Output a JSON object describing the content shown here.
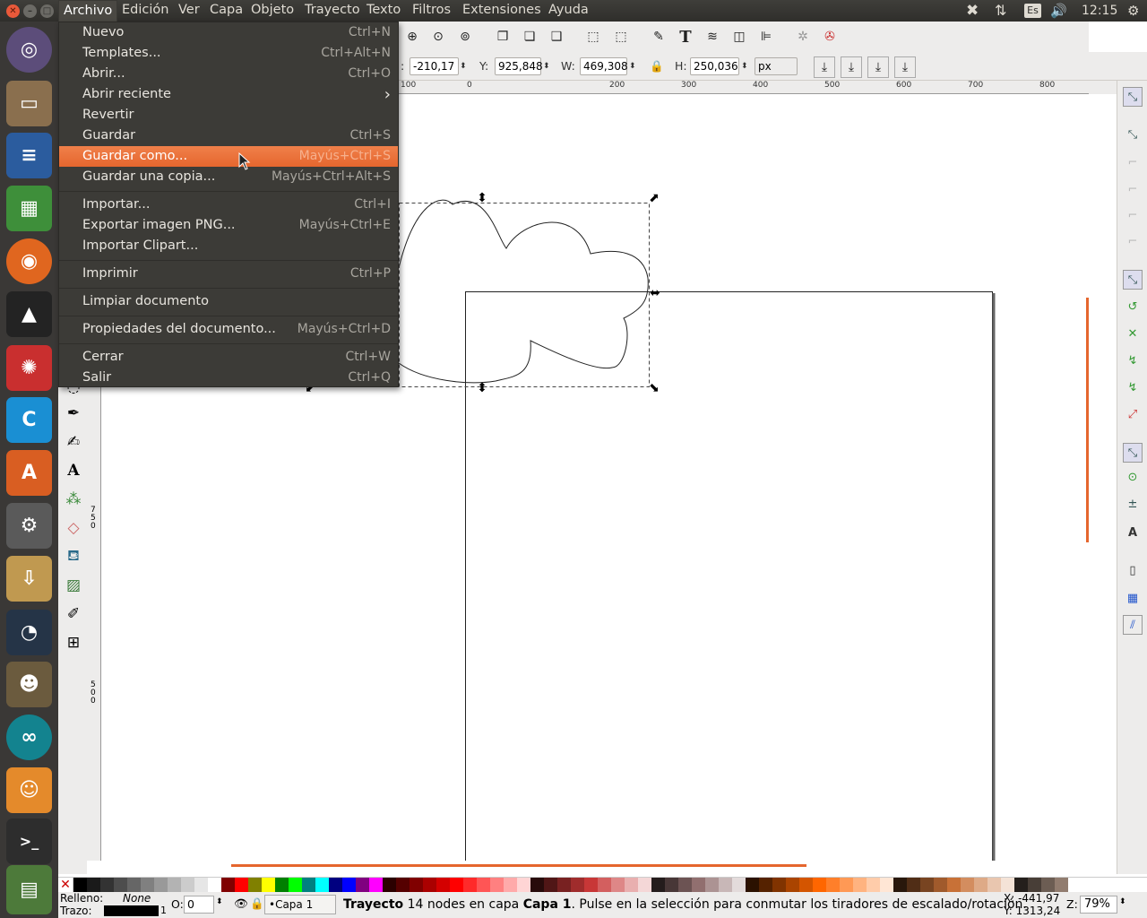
{
  "topbar": {
    "menus": [
      {
        "label": "Archivo"
      },
      {
        "label": "Edición"
      },
      {
        "label": "Ver"
      },
      {
        "label": "Capa"
      },
      {
        "label": "Objeto"
      },
      {
        "label": "Trayecto"
      },
      {
        "label": "Texto"
      },
      {
        "label": "Filtros"
      },
      {
        "label": "Extensiones"
      },
      {
        "label": "Ayuda"
      }
    ],
    "keyboard": "Es",
    "time": "12:15"
  },
  "filemenu": {
    "items": [
      {
        "label": "Nuevo",
        "shortcut": "Ctrl+N"
      },
      {
        "label": "Templates...",
        "shortcut": "Ctrl+Alt+N"
      },
      {
        "label": "Abrir...",
        "shortcut": "Ctrl+O"
      },
      {
        "label": "Abrir reciente",
        "shortcut": "›"
      },
      {
        "label": "Revertir",
        "shortcut": ""
      },
      {
        "label": "Guardar",
        "shortcut": "Ctrl+S"
      },
      {
        "label": "Guardar como...",
        "shortcut": "Mayús+Ctrl+S"
      },
      {
        "label": "Guardar una copia...",
        "shortcut": "Mayús+Ctrl+Alt+S"
      },
      {
        "label": "Importar...",
        "shortcut": "Ctrl+I"
      },
      {
        "label": "Exportar imagen PNG...",
        "shortcut": "Mayús+Ctrl+E"
      },
      {
        "label": "Importar Clipart...",
        "shortcut": ""
      },
      {
        "label": "Imprimir",
        "shortcut": "Ctrl+P"
      },
      {
        "label": "Limpiar documento",
        "shortcut": ""
      },
      {
        "label": "Propiedades del documento...",
        "shortcut": "Mayús+Ctrl+D"
      },
      {
        "label": "Cerrar",
        "shortcut": "Ctrl+W"
      },
      {
        "label": "Salir",
        "shortcut": "Ctrl+Q"
      }
    ]
  },
  "toolctrl": {
    "x_value": "-210,17",
    "y_label": "Y:",
    "y_value": "925,848",
    "w_label": "W:",
    "w_value": "469,308",
    "h_label": "H:",
    "h_value": "250,036",
    "unit": "px"
  },
  "ruler": {
    "h_ticks": [
      "100",
      "0",
      "100",
      "200",
      "300",
      "400",
      "500",
      "600",
      "700",
      "800"
    ],
    "v_ticks": [
      "7 5 0",
      "5 0 0"
    ]
  },
  "status": {
    "fill_label": "Relleno:",
    "fill_value": "None",
    "stroke_label": "Trazo:",
    "stroke_width": "1",
    "opacity_label": "O:",
    "opacity_value": "0",
    "layer": "•Capa 1",
    "msg_bold": "Trayecto",
    "msg_1": " 14 nodes en capa ",
    "msg_layer": "Capa 1",
    "msg_2": ". Pulse en la selección para conmutar los tiradores de escalado/rotación.",
    "coord_x": "X: -441,97",
    "coord_y": "Y: 1313,24",
    "zoom_label": "Z:",
    "zoom_value": "79%"
  },
  "colors": {
    "accent": "#e5662e",
    "panel": "#3c3b37",
    "palette": [
      "#000000",
      "#1a1a1a",
      "#333333",
      "#4d4d4d",
      "#666666",
      "#808080",
      "#999999",
      "#b3b3b3",
      "#cccccc",
      "#e6e6e6",
      "#ffffff",
      "#800000",
      "#ff0000",
      "#808000",
      "#ffff00",
      "#008000",
      "#00ff00",
      "#008080",
      "#00ffff",
      "#000080",
      "#0000ff",
      "#800080",
      "#ff00ff",
      "#2b0000",
      "#550000",
      "#800000",
      "#aa0000",
      "#d40000",
      "#ff0000",
      "#ff2a2a",
      "#ff5555",
      "#ff8080",
      "#ffaaaa",
      "#ffd5d5",
      "#280b0b",
      "#501616",
      "#782121",
      "#a02c2c",
      "#c83737",
      "#d35f5f",
      "#de8787",
      "#e9afaf",
      "#f4d7d7",
      "#241c1c",
      "#483737",
      "#6c5353",
      "#916f6f",
      "#ac9393",
      "#c8b7b7",
      "#e3dbdb",
      "#2b1100",
      "#552200",
      "#803300",
      "#aa4400",
      "#d45500",
      "#ff6600",
      "#ff7f2a",
      "#ff9955",
      "#ffb380",
      "#ffccaa",
      "#ffe6d5",
      "#28170b",
      "#502d16",
      "#784421",
      "#a05a2c",
      "#c87137",
      "#d38d5f",
      "#deaa87",
      "#e9c6af",
      "#f4e3d7",
      "#241f1c",
      "#483e37",
      "#6c5d53",
      "#917c6f"
    ]
  }
}
